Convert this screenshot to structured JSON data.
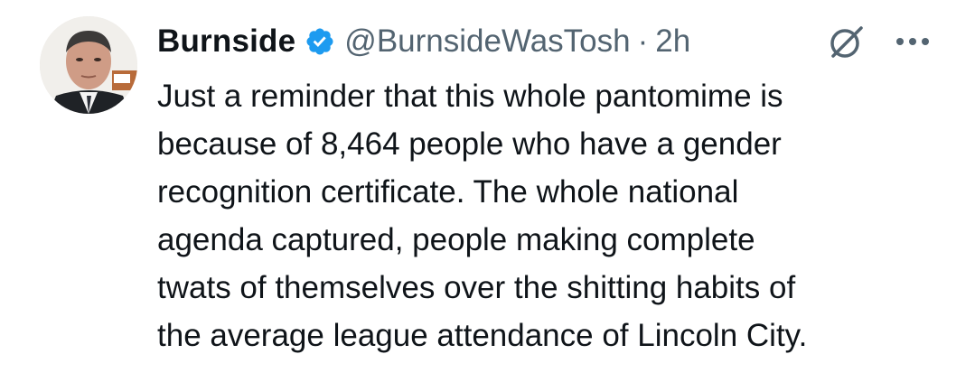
{
  "tweet": {
    "display_name": "Burnside",
    "handle": "@BurnsideWasTosh",
    "separator": "·",
    "time": "2h",
    "verified": true,
    "accent_color": "#1d9bf0",
    "icons": {
      "verified": "verified-badge-icon",
      "grok": "grok-icon",
      "more": "more-icon"
    },
    "lines": [
      "Just a reminder that this whole pantomime is",
      "because of 8,464 people who have a gender",
      "recognition certificate. The whole national",
      "agenda captured, people making complete",
      "twats of themselves over the shitting habits of",
      "the average league attendance of Lincoln City."
    ]
  }
}
